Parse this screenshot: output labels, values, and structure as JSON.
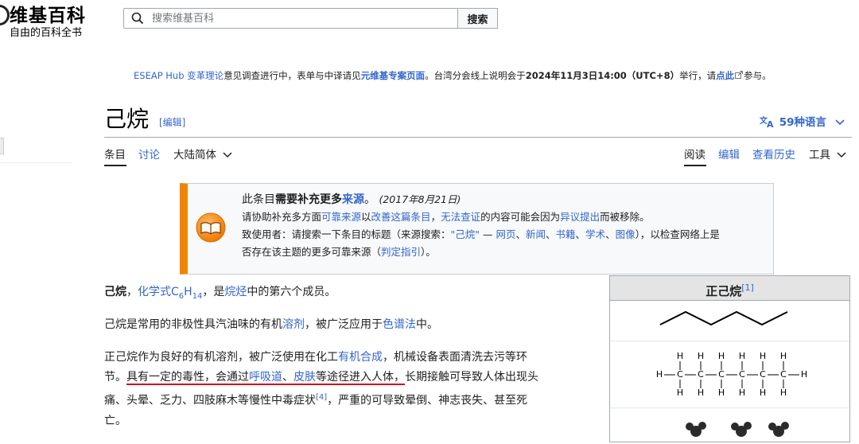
{
  "header": {
    "wordmark": "维基百科",
    "tagline": "自由的百科全书",
    "search_placeholder": "搜索维基百科",
    "search_button": "搜索"
  },
  "notice": {
    "link1": "ESEAP Hub 变革理论",
    "text1": "意见调查进行中，表单与中译请见",
    "link2": "元维基专案页面",
    "text2": "。台湾分会线上说明会于",
    "bold1": "2024年11月3日14:00（UTC+8）",
    "text3": "举行，请",
    "link3": "点此",
    "text4": "参与。"
  },
  "page": {
    "title": "己烷",
    "title_edit": "[编辑]",
    "languages": "59种语言"
  },
  "tabs": {
    "article": "条目",
    "talk": "讨论",
    "variant": "大陆简体",
    "read": "阅读",
    "edit": "编辑",
    "history": "查看历史",
    "tools": "工具"
  },
  "ambox": {
    "line1_pre": "此条目",
    "line1_bold": "需要补充更多",
    "line1_link": "来源",
    "line1_post": "。",
    "line1_date": "(2017年8月21日)",
    "line2_a": "请协助补充多方面",
    "line2_link1": "可靠来源",
    "line2_b": "以",
    "line2_link2": "改善这篇条目",
    "line2_c": "，",
    "line2_link3": "无法查证",
    "line2_d": "的内容可能会因为",
    "line2_link4": "异议提出",
    "line2_e": "而被移除。",
    "line3_a": "致使用者：请搜索一下条目的标题（来源搜索：",
    "line3_link1": "\"己烷\"",
    "line3_b": " — ",
    "line3_link2": "网页",
    "line3_link3": "新闻",
    "line3_link4": "书籍",
    "line3_link5": "学术",
    "line3_link6": "图像",
    "line3_c": "），以检查网络上是",
    "line4_a": "否存在该主题的更多可靠来源（",
    "line4_link": "判定指引",
    "line4_b": "）。"
  },
  "body": {
    "p1_bold": "己烷",
    "p1_sep": "，",
    "p1_link1": "化学式C",
    "p1_sub1": "6",
    "p1_link1b": "H",
    "p1_sub2": "14",
    "p1_mid": "，是",
    "p1_link2": "烷烃",
    "p1_end": "中的第六个成员。",
    "p2_a": "己烷是常用的非极性具汽油味的有机",
    "p2_link": "溶剂",
    "p2_b": "，被广泛应用于",
    "p2_link2": "色谱法",
    "p2_c": "中。",
    "p3_a": "正己烷作为良好的有机溶剂，被广泛使用在化工",
    "p3_link1": "有机合成",
    "p3_b": "，机械设备表面清洗去污等环",
    "p3_c": "节。",
    "p3_u1": "具有一定的毒性，会通过",
    "p3_link2": "呼吸道",
    "p3_u2": "、",
    "p3_link3": "皮肤",
    "p3_u3": "等途径进入人体，",
    "p3_d": "长期接触可导致人体出现头",
    "p3_e": "痛、头晕、乏力、四肢麻木等慢性中毒症状",
    "p3_ref": "[4]",
    "p3_f": "，严重的可导致晕倒、神志丧失、甚至死",
    "p3_g": "亡。"
  },
  "infobox": {
    "title": "正己烷",
    "title_ref": "[1]",
    "h_label": "H",
    "c_label": "C"
  },
  "colors": {
    "link": "#3366cc",
    "ambox_border": "#f28500",
    "annotation_underline": "#d0101b"
  }
}
